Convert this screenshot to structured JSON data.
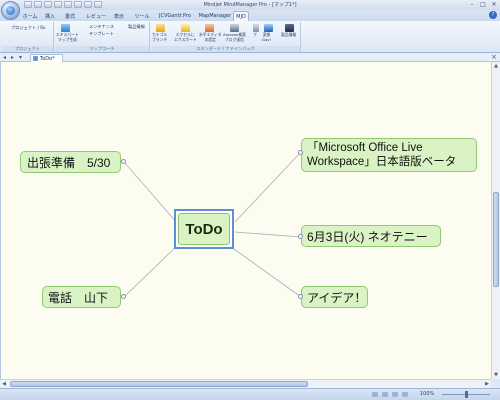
{
  "window": {
    "title": "Mindjet MindManager Pro - [マップ1*]"
  },
  "ribbon_tabs": [
    "ホーム",
    "挿入",
    "書式",
    "レビュー",
    "表示",
    "ツール",
    "JCVGantt Pro",
    "MapManager",
    "MJD"
  ],
  "active_tab_index": 8,
  "ribbon": {
    "group1": {
      "items": [
        "プロジェクト / Ru"
      ],
      "label": "プロジェクト"
    },
    "group2": {
      "items": [
        "エキスパート",
        "マップ生成",
        "メンテナンス",
        "テンプレート",
        "製品情報"
      ],
      "label": "マップコーチ"
    },
    "group3": {
      "buttons": [
        {
          "line1": "カテゴル",
          "line2": "ブランチ"
        },
        {
          "line1": "エクセルに",
          "line2": "エクスポート"
        },
        {
          "line1": "水平エディタ",
          "line2": "の設定"
        },
        {
          "line1": "Amazon検索",
          "line2": "ブログ送信"
        },
        {
          "line1": "ブ",
          "line2": ""
        },
        {
          "line1": "変換",
          "line2": "Gov!"
        },
        {
          "line1": "製品情報",
          "line2": ""
        }
      ],
      "label": "スタンダード / アドインパック"
    }
  },
  "document_tab": {
    "label": "ToDo*"
  },
  "mindmap": {
    "central": "ToDo",
    "topics": {
      "top_left": "出張準備　5/30",
      "bottom_left": "電話　山下",
      "top_right": "「Microsoft Office Live Workspace」日本語版ベータ",
      "mid_right": "6月3日(火) ネオテニー",
      "bottom_right": "アイデア！"
    }
  },
  "statusbar": {
    "zoom": "100%"
  },
  "colors": {
    "topic_fill": "#d9f3c4",
    "topic_border": "#91c972",
    "central_selection": "#5b8fd8",
    "canvas_background": "#fdfcf0",
    "connector": "#a6adb8"
  }
}
